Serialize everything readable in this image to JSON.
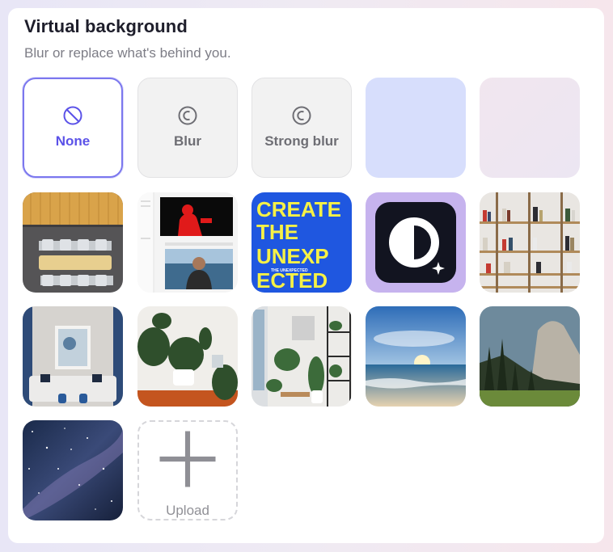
{
  "header": {
    "title": "Virtual background",
    "subtitle": "Blur or replace what's behind you."
  },
  "options": [
    {
      "label": "None",
      "icon": "no-symbol-icon",
      "selected": true
    },
    {
      "label": "Blur",
      "icon": "blur-icon",
      "selected": false
    },
    {
      "label": "Strong blur",
      "icon": "strong-blur-icon",
      "selected": false
    }
  ],
  "colors": {
    "accent": "#5b52e8",
    "swatch_lavender": "#d6dcfb",
    "swatch_pink": "#f0e8f0"
  },
  "backgrounds": [
    "lavender-swatch",
    "pink-swatch",
    "office-meeting-room",
    "video-call-screenshot",
    "create-the-unexpected-poster",
    "app-logo",
    "bookshelf-wall",
    "living-room",
    "plant-room",
    "shelf-room",
    "beach-sunset",
    "mountain-forest",
    "starry-sky"
  ],
  "poster": {
    "lines": [
      "CREATE",
      "THE",
      "UNEXP",
      "ECTED"
    ],
    "tagline": "THE UNEXPECTED"
  },
  "upload": {
    "label": "Upload"
  }
}
